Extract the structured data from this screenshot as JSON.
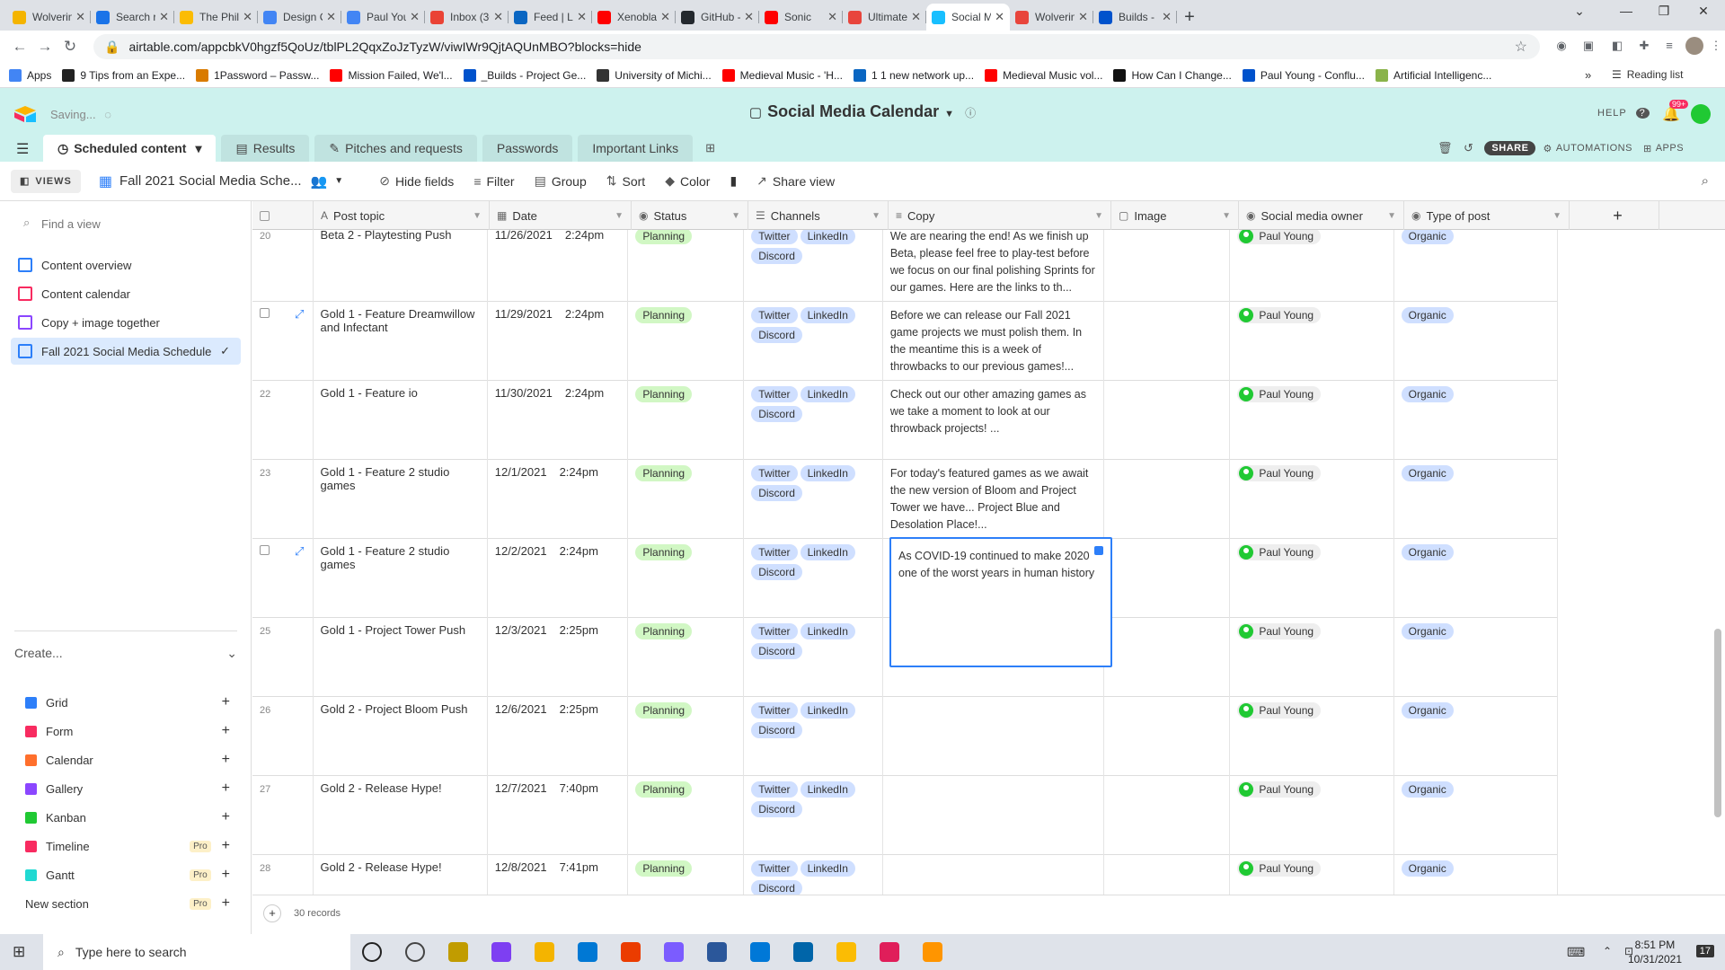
{
  "browser": {
    "tabs": [
      "Wolverine",
      "Search res",
      "The Philos",
      "Design Ch",
      "Paul Youn",
      "Inbox (30",
      "Feed | Lin",
      "Xenoblad",
      "GitHub - F",
      "Sonic",
      "Ultimaten",
      "Social Me",
      "Wolverine",
      "Builds - P"
    ],
    "tab_colors": [
      "#f4b400",
      "#1a73e8",
      "#fbbc04",
      "#4285f4",
      "#4285f4",
      "#ea4335",
      "#0a66c2",
      "#ff0000",
      "#24292e",
      "#ff0000",
      "#e8453c",
      "#18bfff",
      "#e8453c",
      "#0052cc"
    ],
    "url": "airtable.com/appcbkV0hgzf5QoUz/tblPL2QqxZoJzTyzW/viwIWr9QjtAQUnMBO?blocks=hide",
    "bookmarks": [
      "Apps",
      "9 Tips from an Expe...",
      "1Password – Passw...",
      "Mission Failed, We'l...",
      "_Builds - Project Ge...",
      "University of Michi...",
      "Medieval Music - 'H...",
      "1 1 new network up...",
      "Medieval Music vol...",
      "How Can I Change...",
      "Paul Young - Conflu...",
      "Artificial Intelligenc..."
    ],
    "bookmark_colors": [
      "#4285f4",
      "#222",
      "#d97b00",
      "#ff0000",
      "#0052cc",
      "#333",
      "#ff0000",
      "#0a66c2",
      "#ff0000",
      "#111",
      "#0052cc",
      "#8ab34a"
    ],
    "reading_list": "Reading list"
  },
  "airtable": {
    "saving": "Saving...",
    "base_title": "Social Media Calendar",
    "help": "HELP",
    "notif_badge": "99+",
    "tables": [
      "Scheduled content",
      "Results",
      "Pitches and requests",
      "Passwords",
      "Important Links"
    ],
    "share": "SHARE",
    "automations": "AUTOMATIONS",
    "apps": "APPS",
    "views_label": "VIEWS",
    "current_view": "Fall 2021 Social Media Sche...",
    "toolbar": [
      "Hide fields",
      "Filter",
      "Group",
      "Sort",
      "Color",
      "Share view"
    ],
    "find_view": "Find a view",
    "views": [
      "Content overview",
      "Content calendar",
      "Copy + image together",
      "Fall 2021 Social Media Schedule"
    ],
    "view_colors": [
      "#2d7ff9",
      "#f82b60",
      "#8b46ff",
      "#2d7ff9"
    ],
    "create": "Create...",
    "create_items": [
      {
        "label": "Grid",
        "color": "#2d7ff9",
        "pro": ""
      },
      {
        "label": "Form",
        "color": "#f82b60",
        "pro": ""
      },
      {
        "label": "Calendar",
        "color": "#ff6f2c",
        "pro": ""
      },
      {
        "label": "Gallery",
        "color": "#8b46ff",
        "pro": ""
      },
      {
        "label": "Kanban",
        "color": "#20c933",
        "pro": ""
      },
      {
        "label": "Timeline",
        "color": "#f82b60",
        "pro": "Pro"
      },
      {
        "label": "Gantt",
        "color": "#20d9d2",
        "pro": "Pro"
      },
      {
        "label": "New section",
        "color": "",
        "pro": "Pro"
      }
    ],
    "columns": [
      "Post topic",
      "Date",
      "Status",
      "Channels",
      "Copy",
      "Image",
      "Social media owner",
      "Type of post"
    ],
    "rows": [
      {
        "num": "20",
        "topic": "Beta 2 - Playtesting Push",
        "date": "11/26/2021",
        "time": "2:24pm",
        "status": "Planning",
        "copy": "We are nearing the end! As we finish up Beta, please feel free to play-test before we focus on our final polishing Sprints for our games. Here are the links to th...",
        "owner": "Paul Young",
        "type": "Organic"
      },
      {
        "num": "",
        "topic": "Gold 1 - Feature Dreamwillow and Infectant",
        "date": "11/29/2021",
        "time": "2:24pm",
        "status": "Planning",
        "copy": "Before we can release our Fall 2021 game projects we must polish them. In the meantime this is a week of throwbacks to our previous games!...",
        "owner": "Paul Young",
        "type": "Organic"
      },
      {
        "num": "22",
        "topic": "Gold 1 - Feature io",
        "date": "11/30/2021",
        "time": "2:24pm",
        "status": "Planning",
        "copy": "Check out our other amazing games as we take a moment to look at our throwback projects! ...",
        "owner": "Paul Young",
        "type": "Organic"
      },
      {
        "num": "23",
        "topic": "Gold 1 - Feature 2 studio games",
        "date": "12/1/2021",
        "time": "2:24pm",
        "status": "Planning",
        "copy": "For today's featured games as we await the new version of Bloom and Project Tower we have... Project Blue and Desolation Place!...",
        "owner": "Paul Young",
        "type": "Organic"
      },
      {
        "num": "",
        "topic": "Gold 1 - Feature 2 studio games",
        "date": "12/2/2021",
        "time": "2:24pm",
        "status": "Planning",
        "copy": "",
        "owner": "Paul Young",
        "type": "Organic"
      },
      {
        "num": "25",
        "topic": "Gold 1 - Project Tower Push",
        "date": "12/3/2021",
        "time": "2:25pm",
        "status": "Planning",
        "copy": "",
        "owner": "Paul Young",
        "type": "Organic"
      },
      {
        "num": "26",
        "topic": "Gold 2  - Project Bloom Push",
        "date": "12/6/2021",
        "time": "2:25pm",
        "status": "Planning",
        "copy": "",
        "owner": "Paul Young",
        "type": "Organic"
      },
      {
        "num": "27",
        "topic": "Gold 2 - Release Hype!",
        "date": "12/7/2021",
        "time": "7:40pm",
        "status": "Planning",
        "copy": "",
        "owner": "Paul Young",
        "type": "Organic"
      },
      {
        "num": "28",
        "topic": "Gold 2 - Release Hype!",
        "date": "12/8/2021",
        "time": "7:41pm",
        "status": "Planning",
        "copy": "",
        "owner": "Paul Young",
        "type": "Organic"
      }
    ],
    "channels": [
      "Twitter",
      "LinkedIn",
      "Discord"
    ],
    "selected_copy": "As COVID-19 continued to make 2020 one of the worst years in human history",
    "record_count": "30 records"
  },
  "taskbar": {
    "search_placeholder": "Type here to search",
    "time": "8:51 PM",
    "date": "10/31/2021",
    "notif": "17"
  }
}
